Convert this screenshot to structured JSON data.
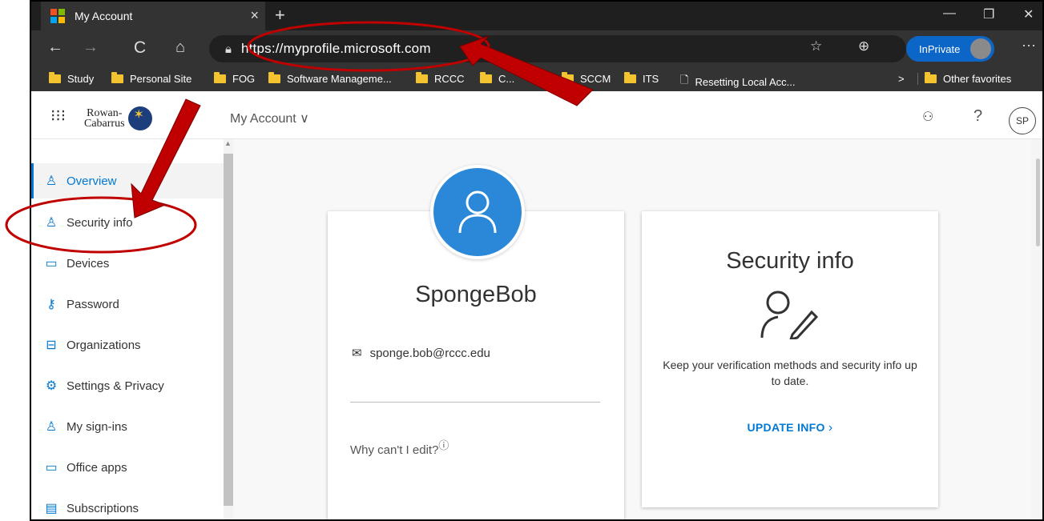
{
  "browser": {
    "tab_title": "My Account",
    "tab_close": "×",
    "new_tab": "+",
    "window_controls": {
      "minimize": "—",
      "restore": "❐",
      "close": "✕"
    },
    "nav": {
      "back": "←",
      "forward": "→",
      "refresh": "C",
      "home": "⌂"
    },
    "url": "https://myprofile.microsoft.com",
    "inprivate_label": "InPrivate",
    "more": "···",
    "bookmarks": [
      {
        "label": "Study"
      },
      {
        "label": "Personal Site"
      },
      {
        "label": "FOG"
      },
      {
        "label": "Software Manageme..."
      },
      {
        "label": "RCCC"
      },
      {
        "label": "C..."
      },
      {
        "label": "SCCM"
      },
      {
        "label": "ITS"
      },
      {
        "label": "Resetting Local Acc..."
      }
    ],
    "bookmarks_overflow": ">",
    "other_favorites": "Other favorites",
    "colors": {
      "chrome_dark": "#1f1f1f",
      "inprivate_blue": "#0c66c8",
      "folder_yellow": "#f4c430"
    }
  },
  "app_header": {
    "logo_line1": "Rowan-",
    "logo_line2": "Cabarrus",
    "title": "My Account",
    "title_chevron": "∨",
    "help": "?",
    "avatar_initials": "SP"
  },
  "sidebar": {
    "items": [
      {
        "label": "Overview",
        "icon": "person-icon",
        "active": true
      },
      {
        "label": "Security info",
        "icon": "security-info-icon"
      },
      {
        "label": "Devices",
        "icon": "laptop-icon"
      },
      {
        "label": "Password",
        "icon": "key-icon"
      },
      {
        "label": "Organizations",
        "icon": "briefcase-icon"
      },
      {
        "label": "Settings & Privacy",
        "icon": "gear-icon"
      },
      {
        "label": "My sign-ins",
        "icon": "sign-ins-icon"
      },
      {
        "label": "Office apps",
        "icon": "office-apps-icon"
      },
      {
        "label": "Subscriptions",
        "icon": "subscriptions-icon"
      }
    ],
    "accent": "#0078d4"
  },
  "profile_card": {
    "name": "SpongeBob",
    "email": "sponge.bob@rccc.edu",
    "why_edit": "Why can't I edit?",
    "avatar_color": "#2b88d8"
  },
  "security_card": {
    "title": "Security info",
    "description": "Keep your verification methods and security info up to date.",
    "link_label": "UPDATE INFO",
    "link_chevron": "›"
  },
  "annotations": {
    "color": "#c00000"
  }
}
